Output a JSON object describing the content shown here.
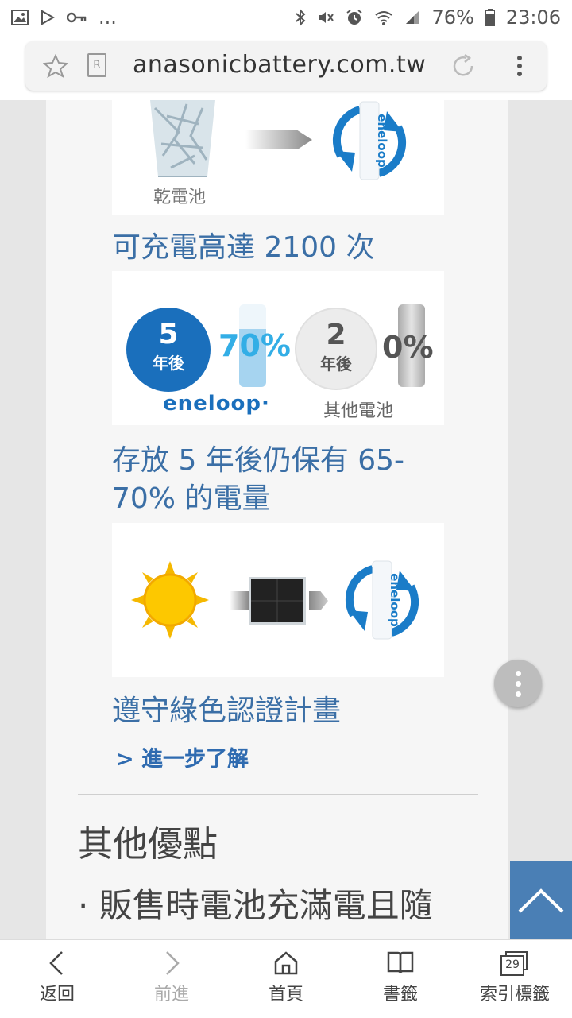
{
  "status_bar": {
    "battery": "76%",
    "time": "23:06",
    "more": "..."
  },
  "browser": {
    "url": "anasonicbattery.com.tw",
    "reader_badge": "R"
  },
  "content": {
    "panel1": {
      "label": "乾電池",
      "brand": "eneloop"
    },
    "caption1": "可充電高達 2100 次",
    "panel2": {
      "eneloop_years": "5",
      "years_after": "年後",
      "eneloop_percent": "70%",
      "other_years": "2",
      "other_percent": "0%",
      "brand": "eneloop",
      "brand_mark": "·",
      "other_label": "其他電池"
    },
    "caption2": "存放 5 年後仍保有 65-70% 的電量",
    "panel3": {
      "brand": "eneloop"
    },
    "caption3": "遵守綠色認證計畫",
    "more_link": "> 進一步了解",
    "section_title": "其他優點",
    "bullet_text": "· 販售時電池充滿電且隨"
  },
  "bottom_nav": {
    "back": "返回",
    "forward": "前進",
    "home": "首頁",
    "bookmarks": "書籤",
    "tabs": "索引標籤",
    "tab_count": "29"
  },
  "colors": {
    "accent_blue": "#3b6fa6",
    "eneloop_blue": "#1a7cc8",
    "totop_blue": "#4a7fb5"
  }
}
